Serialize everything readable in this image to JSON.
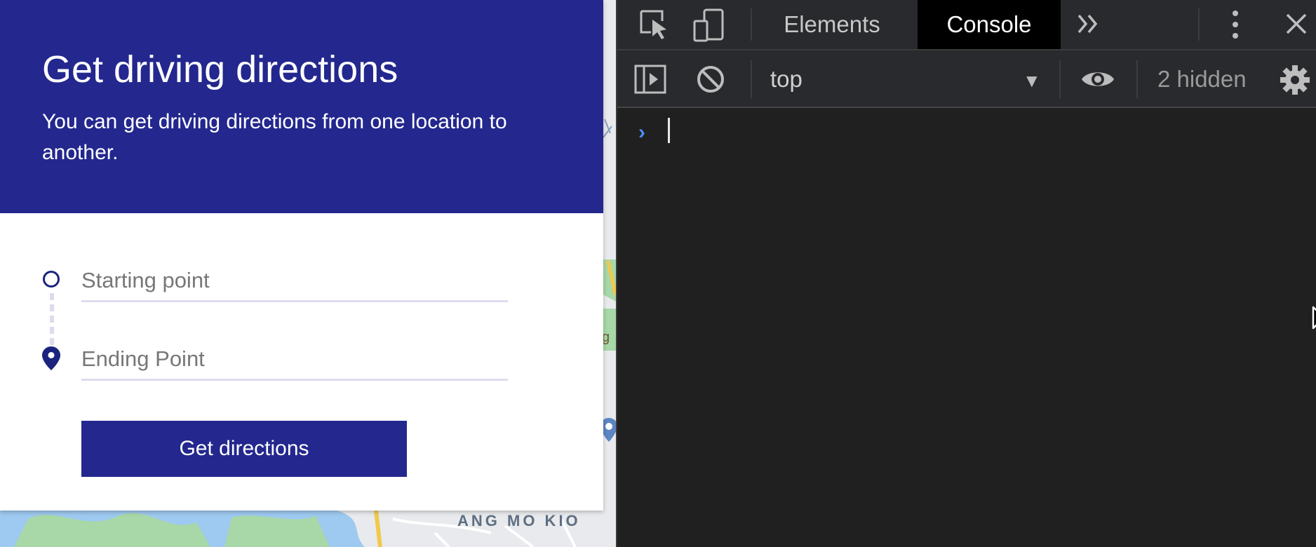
{
  "map": {
    "area_label": "ANG MO KIO",
    "fragment_label": "g"
  },
  "card": {
    "title": "Get driving directions",
    "description": "You can get driving directions from one location to another.",
    "start_placeholder": "Starting point",
    "end_placeholder": "Ending Point",
    "button_label": "Get directions"
  },
  "devtools": {
    "tabs": [
      {
        "label": "Elements",
        "active": false
      },
      {
        "label": "Console",
        "active": true
      }
    ],
    "context": "top",
    "hidden_count": "2 hidden",
    "prompt": "›"
  },
  "colors": {
    "brand": "#23278e",
    "devtools_bg": "#202020",
    "prompt_blue": "#4a8ff5"
  }
}
